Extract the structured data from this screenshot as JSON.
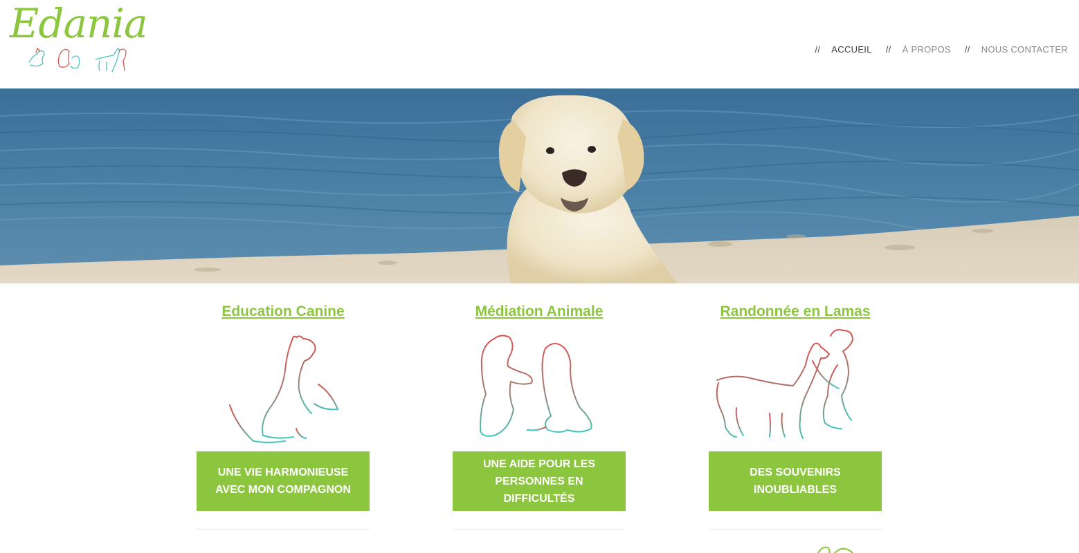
{
  "site": {
    "logo_text": "Edania",
    "brand_color": "#8cc63f"
  },
  "nav": {
    "separator": "//",
    "items": [
      {
        "label": "ACCUEIL",
        "active": true
      },
      {
        "label": "À PROPOS",
        "active": false
      },
      {
        "label": "NOUS CONTACTER",
        "active": false
      }
    ]
  },
  "hero": {
    "image": "golden-retriever-on-beach-photo"
  },
  "services": [
    {
      "title": "Education Canine",
      "illustration": "dog-sitting-icon",
      "tagline": "UNE VIE HARMONIEUSE AVEC MON COMPAGNON"
    },
    {
      "title": "Médiation Animale",
      "illustration": "person-with-dog-icon",
      "tagline": "UNE AIDE POUR LES PERSONNES EN DIFFICULTÉS"
    },
    {
      "title": "Randonnée en Lamas",
      "illustration": "llama-with-hiker-icon",
      "tagline": "DES SOUVENIRS INOUBLIABLES"
    }
  ]
}
